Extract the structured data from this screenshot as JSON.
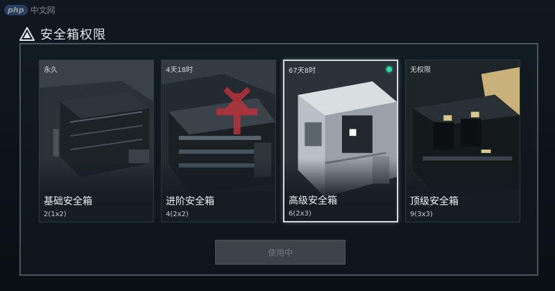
{
  "watermark": {
    "badge": "php",
    "text": "中文网"
  },
  "header": {
    "title": "安全箱权限",
    "icon": "warning-triangle-icon"
  },
  "cards": [
    {
      "time": "永久",
      "name": "基础安全箱",
      "capacity": "2(1x2)",
      "selected": false
    },
    {
      "time": "4天18时",
      "name": "进阶安全箱",
      "capacity": "4(2x2)",
      "selected": false
    },
    {
      "time": "67天8时",
      "name": "高级安全箱",
      "capacity": "6(2x3)",
      "selected": true,
      "status_color": "#2fdca6"
    },
    {
      "time": "无权限",
      "name": "顶级安全箱",
      "capacity": "9(3x3)",
      "selected": false
    }
  ],
  "action": {
    "label": "使用中"
  },
  "colors": {
    "accent_green": "#2fdca6",
    "panel_border": "#4a565e",
    "background": "#0d1419"
  }
}
